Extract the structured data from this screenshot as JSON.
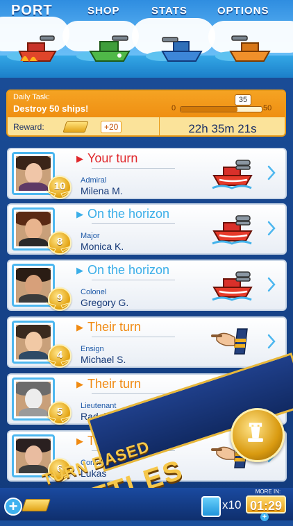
{
  "nav": {
    "port": "PORT",
    "shop": "SHOP",
    "stats": "STATS",
    "options": "OPTIONS"
  },
  "daily_task": {
    "label": "Daily Task:",
    "description": "Destroy 50 ships!",
    "progress_min": "0",
    "progress_max": "50",
    "progress_current": "35",
    "progress_fraction": 0.7,
    "reward_label": "Reward:",
    "reward_amount": "+20",
    "countdown": "22h 35m 21s"
  },
  "games": [
    {
      "status": "Your turn",
      "status_color": "#e0262a",
      "rank": "Admiral",
      "name": "Milena M.",
      "level": "10",
      "icon": "ship-icon"
    },
    {
      "status": "On the horizon",
      "status_color": "#3aaee8",
      "rank": "Major",
      "name": "Monica K.",
      "level": "8",
      "icon": "ship-icon"
    },
    {
      "status": "On the horizon",
      "status_color": "#3aaee8",
      "rank": "Colonel",
      "name": "Gregory G.",
      "level": "9",
      "icon": "ship-icon"
    },
    {
      "status": "Their turn",
      "status_color": "#f08a12",
      "rank": "Ensign",
      "name": "Michael S.",
      "level": "4",
      "icon": "pointing-hand-icon"
    },
    {
      "status": "Their turn",
      "status_color": "#f08a12",
      "rank": "Lieutenant",
      "name": "Radek S.",
      "level": "5",
      "icon": "pointing-hand-icon"
    },
    {
      "status": "Their turn",
      "status_color": "#f08a12",
      "rank": "Commander",
      "name": "Lukas",
      "level": "6",
      "icon": "pointing-hand-icon"
    }
  ],
  "banner": {
    "line1": "TURN BASED",
    "line2": "BATTLES"
  },
  "bottom_bar": {
    "multiplier": "x10",
    "more_in_label": "MORE IN:",
    "timer": "01:29"
  },
  "colors": {
    "accent_blue": "#3aaee8",
    "your_turn_red": "#e0262a",
    "their_turn_orange": "#f08a12",
    "gold": "#e4a514"
  }
}
